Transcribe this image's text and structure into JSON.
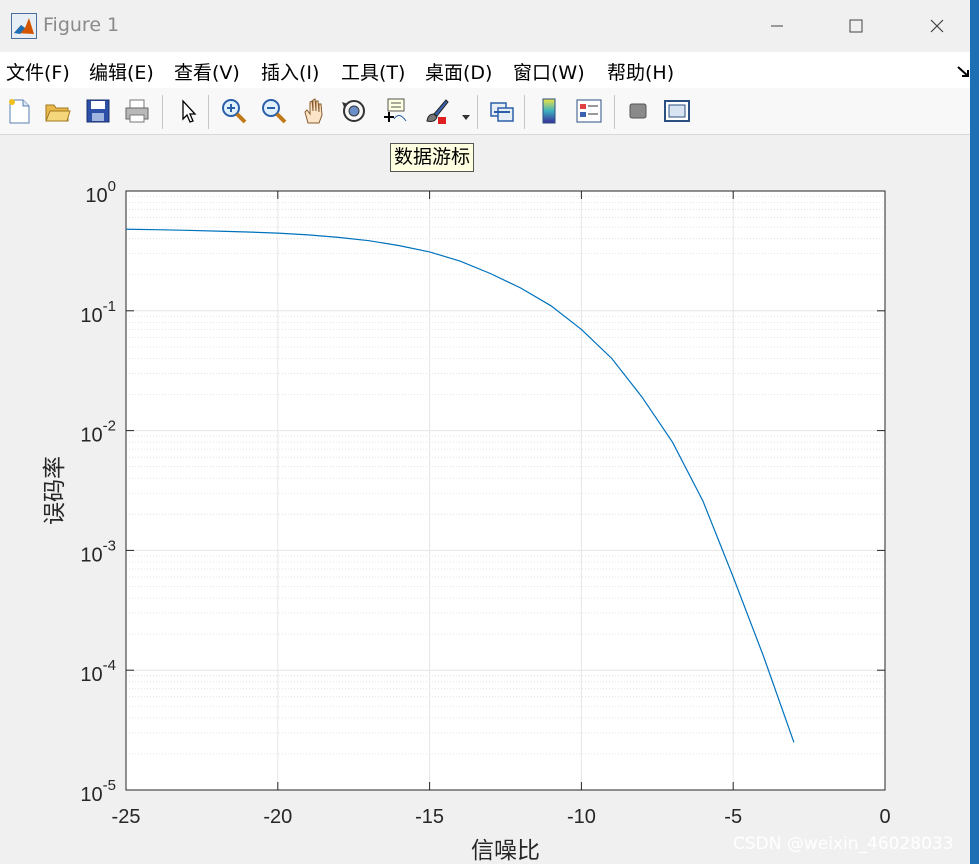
{
  "window": {
    "title": "Figure 1",
    "controls": [
      "minimize",
      "maximize",
      "close"
    ]
  },
  "menu": [
    {
      "label": "文件(F)"
    },
    {
      "label": "编辑(E)"
    },
    {
      "label": "查看(V)"
    },
    {
      "label": "插入(I)"
    },
    {
      "label": "工具(T)"
    },
    {
      "label": "桌面(D)"
    },
    {
      "label": "窗口(W)"
    },
    {
      "label": "帮助(H)"
    }
  ],
  "toolbar": {
    "buttons": [
      "new-figure-icon",
      "open-file-icon",
      "save-icon",
      "print-icon",
      "edit-plot-arrow-icon",
      "zoom-in-icon",
      "zoom-out-icon",
      "pan-hand-icon",
      "rotate-3d-icon",
      "data-cursor-icon",
      "brush-icon",
      "link-plot-icon",
      "colorbar-icon",
      "legend-icon",
      "hide-plot-tools-icon",
      "show-plot-tools-icon"
    ],
    "tooltip": "数据游标"
  },
  "colors": {
    "series": "#0072bd",
    "grid": "#e6e6e6",
    "axis": "#262626"
  },
  "chart_data": {
    "type": "line",
    "xlabel": "信噪比",
    "ylabel": "误码率",
    "xlim": [
      -25,
      0
    ],
    "ylim": [
      1e-05,
      1
    ],
    "yscale": "log",
    "grid": true,
    "x_ticks": [
      "-25",
      "-20",
      "-15",
      "-10",
      "-5",
      "0"
    ],
    "y_ticks": [
      {
        "base": "10",
        "exp": "-5"
      },
      {
        "base": "10",
        "exp": "-4"
      },
      {
        "base": "10",
        "exp": "-3"
      },
      {
        "base": "10",
        "exp": "-2"
      },
      {
        "base": "10",
        "exp": "-1"
      },
      {
        "base": "10",
        "exp": "0"
      }
    ],
    "series": [
      {
        "x": [
          -25,
          -24,
          -23,
          -22,
          -21,
          -20,
          -19,
          -18,
          -17,
          -16,
          -15,
          -14,
          -13,
          -12,
          -11,
          -10,
          -9,
          -8,
          -7,
          -6,
          -5,
          -4,
          -3
        ],
        "values": [
          0.48,
          0.475,
          0.47,
          0.463,
          0.455,
          0.445,
          0.43,
          0.41,
          0.385,
          0.35,
          0.31,
          0.26,
          0.205,
          0.155,
          0.11,
          0.07,
          0.04,
          0.019,
          0.008,
          0.0026,
          0.0006,
          0.00013,
          2.5e-05
        ]
      }
    ]
  },
  "watermark": "CSDN @weixin_46028033"
}
